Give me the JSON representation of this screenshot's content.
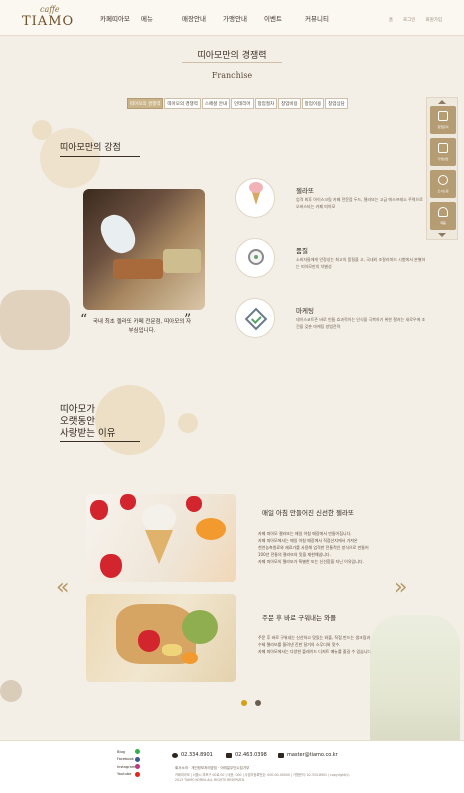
{
  "brand": {
    "logo_top": "caffe",
    "logo_main": "TIAMO"
  },
  "nav": [
    "카페띠아모",
    "메뉴",
    "매장안내",
    "가맹안내",
    "이벤트",
    "커뮤니티"
  ],
  "util": [
    "홈",
    "로그인",
    "회원가입"
  ],
  "page": {
    "title": "띠아모만의 경쟁력",
    "subtitle": "Franchise"
  },
  "tabs": [
    "띠아모의 경쟁력",
    "띠아모의 경쟁력",
    "스페셜 안내",
    "인테리어",
    "창업절차",
    "창업비용",
    "창업이용",
    "창업상담"
  ],
  "quick_menu": [
    "창업문의",
    "가맹상담",
    "오시는길",
    "제품"
  ],
  "section1": {
    "title": "띠아모만의 강점",
    "quote": "국내 최초 젤라또 카페 전문점, 띠아모의 자부심입니다.",
    "features": [
      {
        "name": "gelato",
        "title": "젤라또",
        "desc": "엄격 최후 아이스크림 카페 전문점 두드, 젤라또는 고급 에스프레소 주력으로 오버스타는 카페 띠아모"
      },
      {
        "name": "quality",
        "title": "품질",
        "desc": "소비자들에게 안정성는 최고의 품질을 고, 국내외 조절라피드 시험에서 분별하는 띠아모만의 차별성"
      },
      {
        "name": "marketing",
        "title": "마케팅",
        "desc": "데이스코트즌 바로 빈틈 효과적이는 인식을 극복하기 위한 철저는 새로우에 조건을 갖춘 마케팅 방법전략"
      }
    ]
  },
  "section2": {
    "title": "띠아모가\n오랫동안\n사랑받는 이유",
    "menus": [
      {
        "title": "매일 아침 만들어진 신선한 젤라또",
        "desc": [
          "카페 띠아모 젤라또는 매일 아침 매장에서 만들어집니다.",
          "카페 띠아모에서는 매일 아침 매장에서 직접산지에서 가져온",
          "천연농축원료와 재료가를 사용해 엄격한 전통적인 방식으로 만들어",
          "100년 전통의 젤라또의 맛을 재현해냅니다.",
          "카페 띠아모의 젤라또가 특별한 또는 신선함을 지닌 이유입니다."
        ]
      },
      {
        "title": "주문 후 바로 구워내는 와플",
        "desc": [
          "주문 후 바로 구워내는 신선하고 맛있는 와플, 직접 만드는 생크림과",
          "수제 젤라또를 올려낸 진한 달거의 스무디와 맛수.",
          "카페 띠아모에서는 다양한 플레이드 디저트 메뉴를 즐길 수 있습니다."
        ]
      }
    ]
  },
  "footer": {
    "social": [
      "Blog",
      "Facebook",
      "Instagram",
      "Youtube"
    ],
    "phone1": "02.334.8901",
    "phone2": "02.463.0398",
    "email": "master@tiamo.co.kr",
    "links": "회사소개 · 개인정보처리방침 · 이메일무단수집거부",
    "address": "카페띠아모 | 서울시 마포구 00로 00 | 대표: 000 | 사업자등록번호: 000-00-00000 | 가맹문의: 02.334.8901 / copyright(c) 2013 TIAMO KOREA ALL RIGHTS RESERVED."
  },
  "colors": {
    "accent": "#b59c73",
    "tab_active": "#c9b48c",
    "background": "#f4efe6"
  }
}
